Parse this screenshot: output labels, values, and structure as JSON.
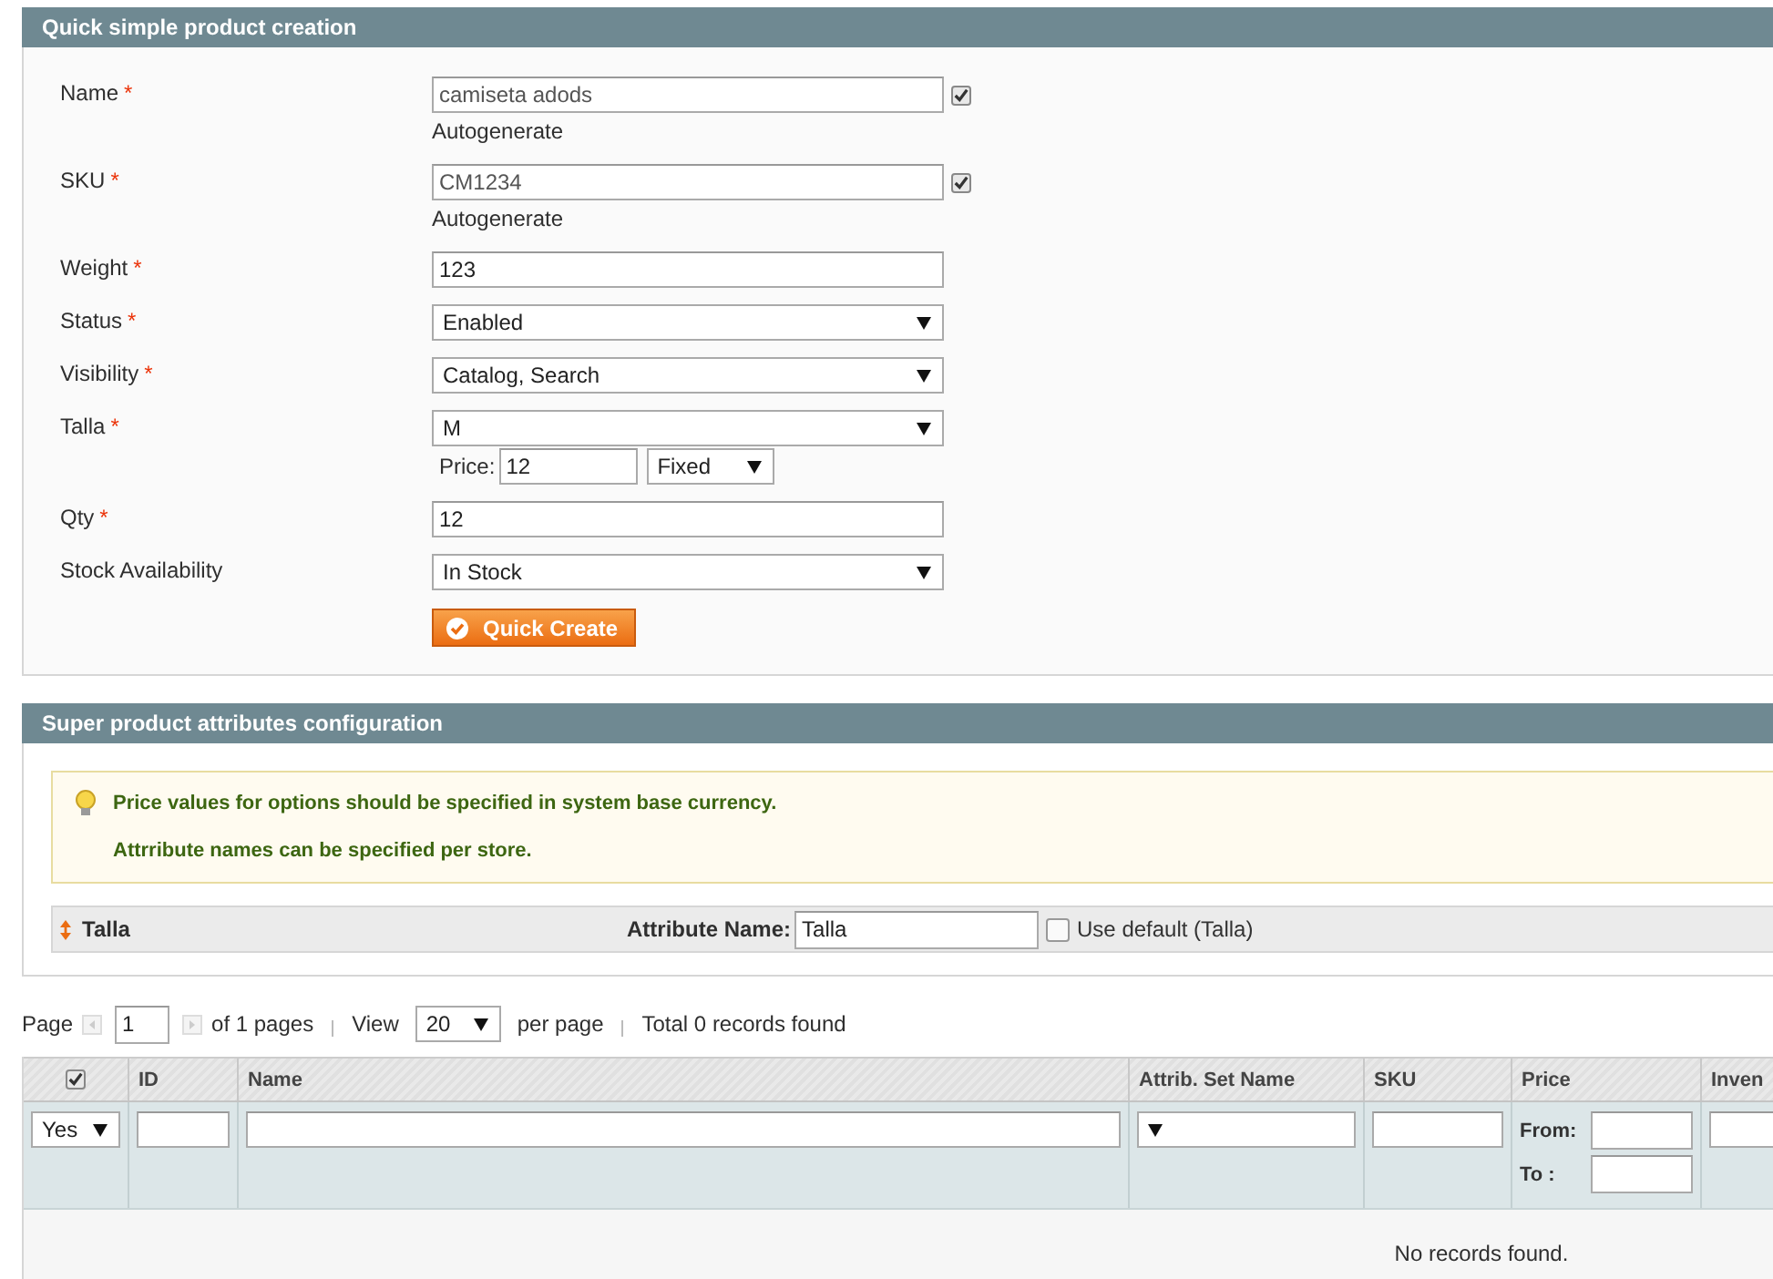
{
  "required_mark": "*",
  "quick_create": {
    "title": "Quick simple product creation",
    "fields": [
      {
        "kind": "text",
        "label": "Name",
        "required": true,
        "value": "camiseta adods",
        "autogenerate": {
          "label": "Autogenerate",
          "checked": true
        }
      },
      {
        "kind": "text",
        "label": "SKU",
        "required": true,
        "value": "CM1234",
        "autogenerate": {
          "label": "Autogenerate",
          "checked": true
        }
      },
      {
        "kind": "text",
        "label": "Weight",
        "required": true,
        "value": "123"
      },
      {
        "kind": "select",
        "label": "Status",
        "required": true,
        "value": "Enabled"
      },
      {
        "kind": "select",
        "label": "Visibility",
        "required": true,
        "value": "Catalog, Search"
      },
      {
        "kind": "select",
        "label": "Talla",
        "required": true,
        "value": "M",
        "price": {
          "label": "Price:",
          "value": "12",
          "type": "Fixed"
        }
      },
      {
        "kind": "text",
        "label": "Qty",
        "required": true,
        "value": "12"
      },
      {
        "kind": "select",
        "label": "Stock Availability",
        "required": false,
        "value": "In Stock"
      }
    ],
    "button": "Quick Create"
  },
  "super_attributes": {
    "title": "Super product attributes configuration",
    "notices": [
      "Price values for options should be specified in system base currency.",
      "Attrribute names can be specified per store."
    ],
    "attribute": {
      "name": "Talla",
      "name_label": "Attribute Name:",
      "value": "Talla",
      "use_default": {
        "label": "Use default (Talla)",
        "checked": false
      }
    }
  },
  "pager": {
    "page_label": "Page",
    "page": "1",
    "of_pages": "of 1 pages",
    "view_label": "View",
    "per_page": "20",
    "per_page_label": "per page",
    "total": "Total 0 records found"
  },
  "grid": {
    "columns": [
      {
        "kind": "checkbox",
        "checked": true
      },
      {
        "kind": "text",
        "label": "ID"
      },
      {
        "kind": "text",
        "label": "Name"
      },
      {
        "kind": "text",
        "label": "Attrib. Set Name"
      },
      {
        "kind": "text",
        "label": "SKU"
      },
      {
        "kind": "text",
        "label": "Price"
      },
      {
        "kind": "text",
        "label": "Inven"
      }
    ],
    "filters": [
      {
        "kind": "select",
        "value": "Yes"
      },
      {
        "kind": "text"
      },
      {
        "kind": "text"
      },
      {
        "kind": "select"
      },
      {
        "kind": "text"
      },
      {
        "kind": "range",
        "from_label": "From:",
        "to_label": "To :"
      },
      {
        "kind": "text"
      }
    ],
    "empty_message": "No records found."
  }
}
